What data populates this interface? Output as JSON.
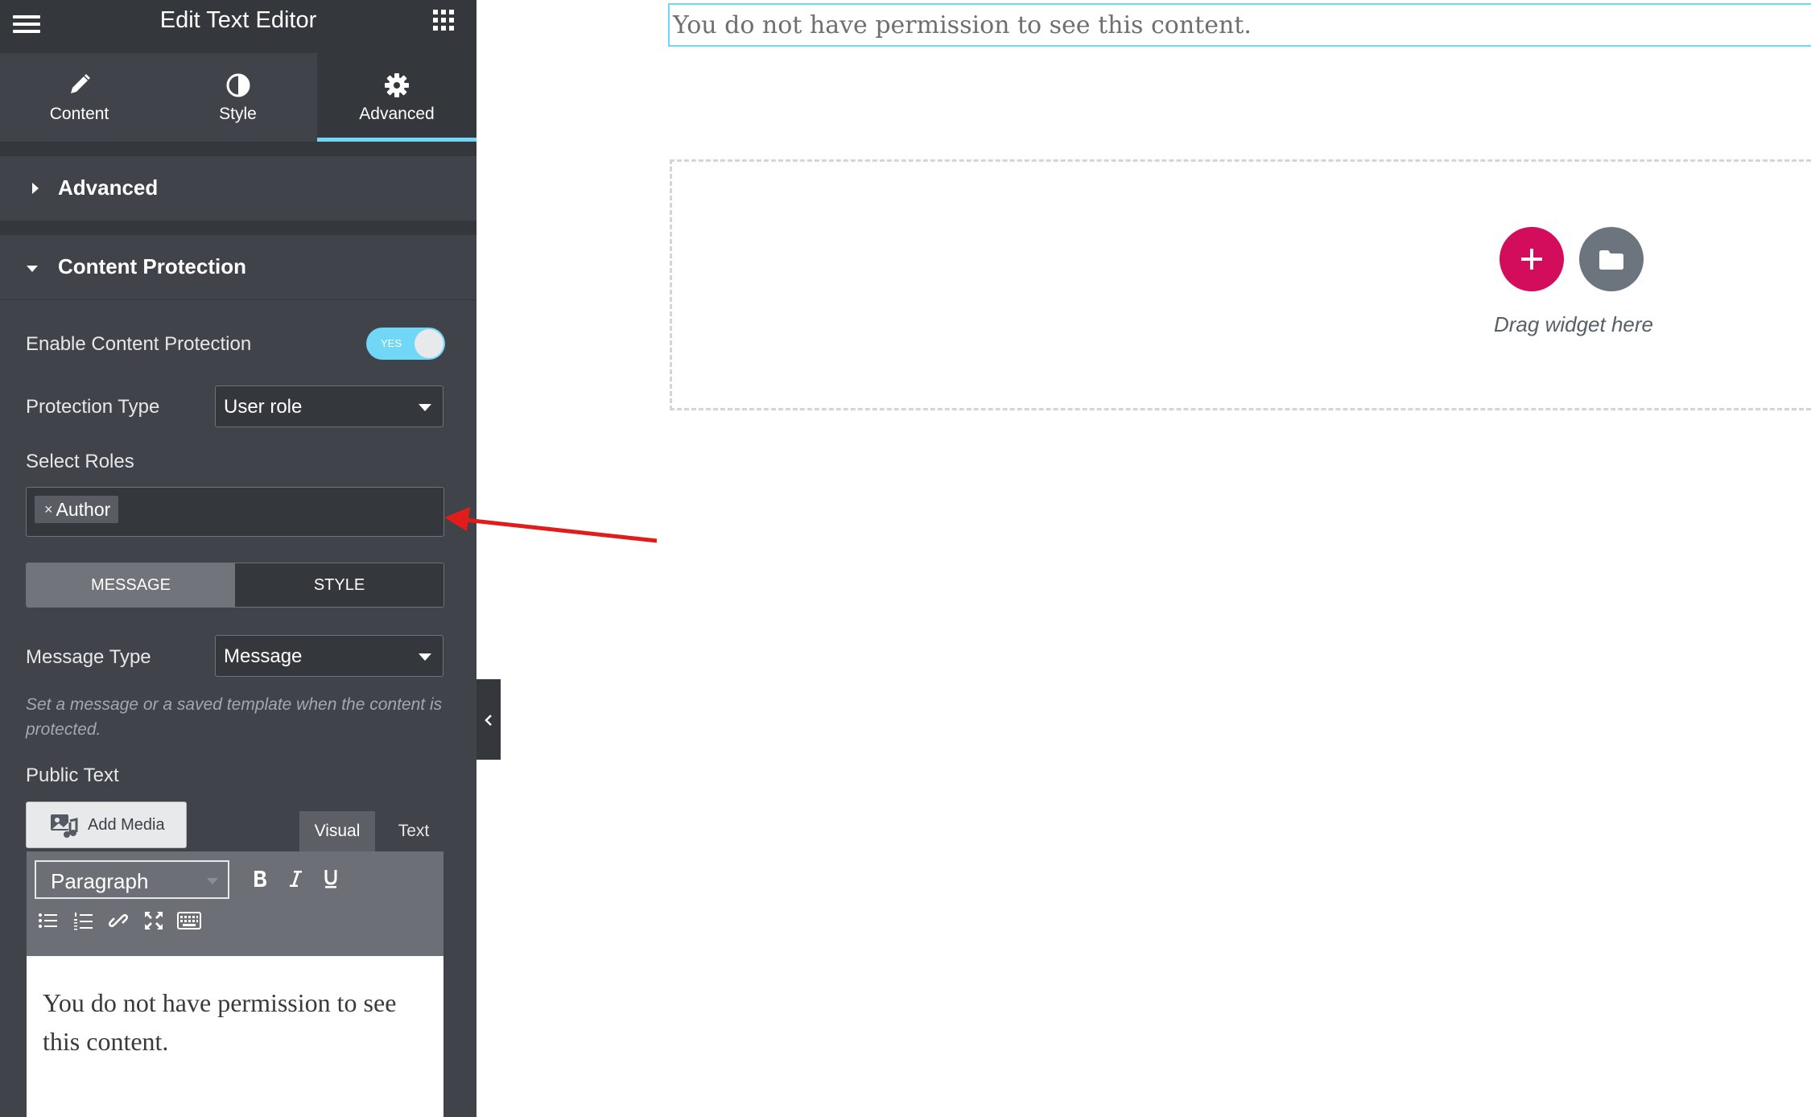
{
  "topbar": {
    "title": "Edit Text Editor"
  },
  "tabs": [
    {
      "label": "Content"
    },
    {
      "label": "Style"
    },
    {
      "label": "Advanced"
    }
  ],
  "sections": {
    "advanced": "Advanced",
    "content_protection": "Content Protection"
  },
  "controls": {
    "enable_label": "Enable Content Protection",
    "toggle_text": "YES",
    "protection_type_label": "Protection Type",
    "protection_type_value": "User role",
    "select_roles_label": "Select Roles",
    "roles": [
      "Author"
    ],
    "switcher": [
      "MESSAGE",
      "STYLE"
    ],
    "message_type_label": "Message Type",
    "message_type_value": "Message",
    "hint": "Set a message or a saved template when the content is protected.",
    "public_text_label": "Public Text"
  },
  "editor": {
    "add_media": "Add Media",
    "tab_visual": "Visual",
    "tab_text": "Text",
    "format_value": "Paragraph",
    "body_text": "You do not have permission to see this content."
  },
  "canvas": {
    "permission_text": "You do not have permission to see this content.",
    "drag_text": "Drag widget here"
  },
  "colors": {
    "accent": "#71d7f7",
    "add_button": "#d30c5c",
    "panel_bg": "#404349",
    "annotation_arrow": "#e21b1b"
  }
}
